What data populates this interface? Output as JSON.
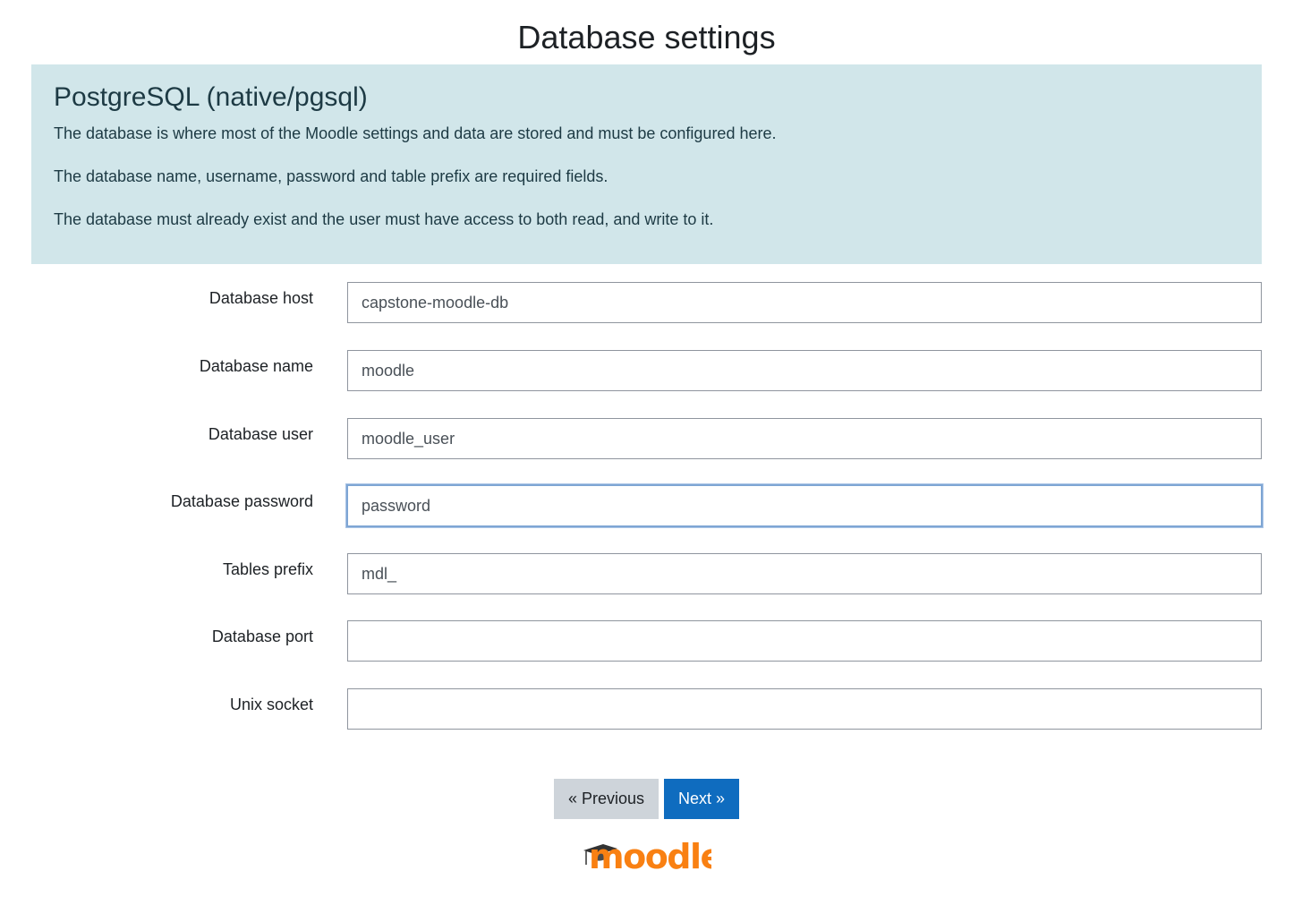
{
  "page": {
    "title": "Database settings"
  },
  "info": {
    "title": "PostgreSQL (native/pgsql)",
    "paragraphs": [
      "The database is where most of the Moodle settings and data are stored and must be configured here.",
      "The database name, username, password and table prefix are required fields.",
      "The database must already exist and the user must have access to both read, and write to it."
    ]
  },
  "form": {
    "fields": [
      {
        "label": "Database host",
        "value": "capstone-moodle-db"
      },
      {
        "label": "Database name",
        "value": "moodle"
      },
      {
        "label": "Database user",
        "value": "moodle_user"
      },
      {
        "label": "Database password",
        "value": "password",
        "focused": true
      },
      {
        "label": "Tables prefix",
        "value": "mdl_"
      },
      {
        "label": "Database port",
        "value": ""
      },
      {
        "label": "Unix socket",
        "value": ""
      }
    ]
  },
  "buttons": {
    "previous": "« Previous",
    "next": "Next »"
  },
  "logo": {
    "text": "moodle",
    "color": "#f98012",
    "cap_color": "#333333"
  },
  "colors": {
    "info_bg": "#d1e6ea",
    "primary": "#0f6cbf",
    "secondary": "#ced4da",
    "focus_border": "#7fa6d4"
  }
}
